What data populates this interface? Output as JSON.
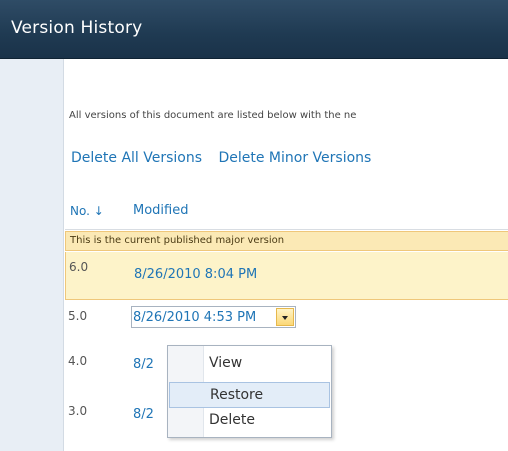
{
  "window": {
    "title": "Version History"
  },
  "description": "All versions of this document are listed below with the ne",
  "actions": {
    "delete_all": "Delete All Versions",
    "delete_minor": "Delete Minor Versions"
  },
  "table": {
    "col_no": "No. ↓",
    "col_modified": "Modified",
    "current_banner": "This is the current published major version",
    "rows": [
      {
        "no": "6.0",
        "modified": "8/26/2010 8:04 PM"
      },
      {
        "no": "5.0",
        "modified": "8/26/2010 4:53 PM"
      },
      {
        "no": "4.0",
        "modified": "8/2"
      },
      {
        "no": "3.0",
        "modified": "8/2"
      }
    ]
  },
  "context_menu": {
    "items": [
      "View",
      "Restore",
      "Delete"
    ],
    "hovered": "Restore"
  },
  "icons": {
    "dropdown": "chevron-down-icon",
    "sort": "sort-desc-icon"
  },
  "colors": {
    "titlebar": "#1f3a52",
    "link": "#1f75b6",
    "highlight": "#fdf3c9"
  }
}
